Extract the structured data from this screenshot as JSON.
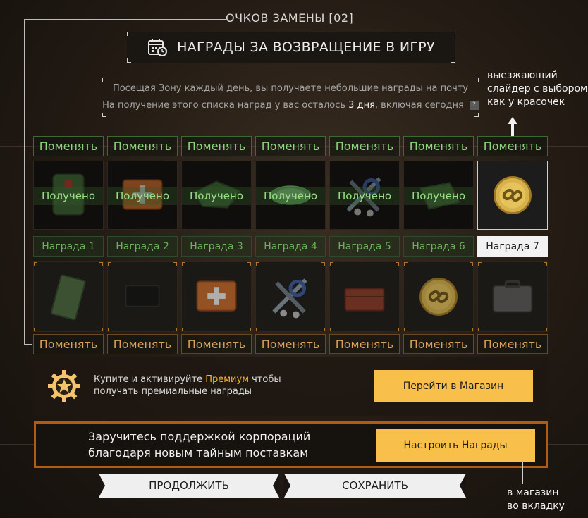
{
  "header": {
    "points_label": "ОЧКОВ ЗАМЕНЫ [02]",
    "title": "НАГРАДЫ ЗА ВОЗВРАЩЕНИЕ В ИГРУ"
  },
  "description": {
    "line1": "Посещая Зону каждый день, вы получаете небольшие награды на почту",
    "line2_prefix": "На получение этого списка наград у вас осталось",
    "line2_days": "3 дня",
    "line2_suffix": ", включая сегодня",
    "help": "?"
  },
  "annotations": {
    "slider_note_1": "выезжающий",
    "slider_note_2": "слайдер с выбором",
    "slider_note_3": "как у красочек",
    "shop_note_1": "в магазин",
    "shop_note_2": "во вкладку"
  },
  "swap_label": "Поменять",
  "received_label": "Получено",
  "rewards": [
    {
      "label": "Награда 1",
      "received": true,
      "icon": "medkit-green-icon",
      "premium_icon": "bandage-pack-icon"
    },
    {
      "label": "Награда 2",
      "received": true,
      "icon": "medkit-orange-icon",
      "premium_icon": "dark-case-icon"
    },
    {
      "label": "Награда 3",
      "received": true,
      "icon": "green-bag-icon",
      "premium_icon": "medkit-orange-icon"
    },
    {
      "label": "Награда 4",
      "received": true,
      "icon": "green-powder-icon",
      "premium_icon": "tools-icon"
    },
    {
      "label": "Награда 5",
      "received": true,
      "icon": "tools-icon",
      "premium_icon": "red-toolbox-icon"
    },
    {
      "label": "Награда 6",
      "received": true,
      "icon": "green-pack-icon",
      "premium_icon": "gold-coin-icon"
    },
    {
      "label": "Награда 7",
      "received": false,
      "icon": "gold-coin-icon",
      "premium_icon": "grey-case-icon"
    }
  ],
  "premium": {
    "text_prefix": "Купите и активируйте",
    "text_highlight": "Премиум",
    "text_suffix": "чтобы",
    "text_line2": "получать премиальные награды",
    "button": "Перейти в Магазин"
  },
  "corporation": {
    "line1": "Заручитесь поддержкой корпораций",
    "line2": "благодаря новым тайным поставкам",
    "button": "Настроить Награды"
  },
  "buttons": {
    "continue": "ПРОДОЛЖИТЬ",
    "save": "СОХРАНИТЬ"
  },
  "colors": {
    "accent_yellow": "#f8bf4a",
    "received_green": "#8ed47f",
    "premium_orange": "#d9a15a",
    "corp_border": "#b15c14"
  }
}
